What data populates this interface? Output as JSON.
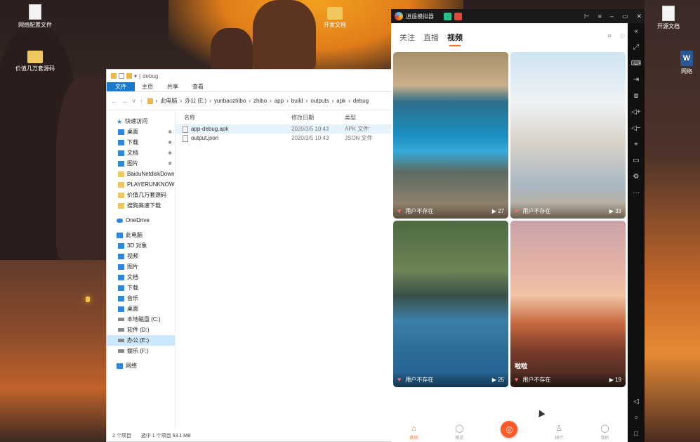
{
  "desktop": {
    "icons": [
      {
        "label": "网络配置文件",
        "kind": "file"
      },
      {
        "label": "价值几万套源码",
        "kind": "folder"
      },
      {
        "label": "开发文档",
        "kind": "folder"
      },
      {
        "label": "开源文档",
        "kind": "file"
      },
      {
        "label": "网络",
        "kind": "word"
      }
    ]
  },
  "explorer": {
    "title": "debug",
    "ribbon_tabs": [
      "文件",
      "主页",
      "共享",
      "查看"
    ],
    "path": [
      "此电脑",
      "办公 (E:)",
      "yunbaozhibo",
      "zhibo",
      "app",
      "build",
      "outputs",
      "apk",
      "debug"
    ],
    "nav": {
      "quick_access": "快速访问",
      "quick_items": [
        {
          "label": "桌面",
          "icon": "blue",
          "pinned": true
        },
        {
          "label": "下载",
          "icon": "blue",
          "pinned": true
        },
        {
          "label": "文档",
          "icon": "blue",
          "pinned": true
        },
        {
          "label": "图片",
          "icon": "blue",
          "pinned": true
        },
        {
          "label": "BaiduNetdiskDown",
          "icon": "yel",
          "pinned": false
        },
        {
          "label": "PLAYERUNKNOWN",
          "icon": "yel",
          "pinned": false
        },
        {
          "label": "价值几万套源码",
          "icon": "yel",
          "pinned": false
        },
        {
          "label": "搜狗高速下载",
          "icon": "yel",
          "pinned": false
        }
      ],
      "onedrive": "OneDrive",
      "this_pc": "此电脑",
      "pc_items": [
        {
          "label": "3D 对象",
          "icon": "blue"
        },
        {
          "label": "视频",
          "icon": "blue"
        },
        {
          "label": "图片",
          "icon": "blue"
        },
        {
          "label": "文档",
          "icon": "blue"
        },
        {
          "label": "下载",
          "icon": "blue"
        },
        {
          "label": "音乐",
          "icon": "blue"
        },
        {
          "label": "桌面",
          "icon": "blue"
        },
        {
          "label": "本地磁盘 (C:)",
          "icon": "gray"
        },
        {
          "label": "软件 (D:)",
          "icon": "gray"
        },
        {
          "label": "办公 (E:)",
          "icon": "gray",
          "selected": true
        },
        {
          "label": "娱乐 (F:)",
          "icon": "gray"
        }
      ],
      "network": "网络"
    },
    "columns": {
      "name": "名称",
      "date": "修改日期",
      "type": "类型"
    },
    "files": [
      {
        "name": "app-debug.apk",
        "date": "2020/3/5 10:43",
        "type": "APK 文件",
        "selected": true
      },
      {
        "name": "output.json",
        "date": "2020/3/5 10:43",
        "type": "JSON 文件",
        "selected": false
      }
    ],
    "status": {
      "count": "2 个项目",
      "selection": "选中 1 个项目  63.1 MB"
    }
  },
  "emulator": {
    "title": "逍遥模拟器",
    "top_tabs": [
      {
        "label": "关注",
        "active": false
      },
      {
        "label": "直播",
        "active": false
      },
      {
        "label": "视频",
        "active": true
      }
    ],
    "cards": [
      {
        "user": "用户不存在",
        "views": "27",
        "caption": ""
      },
      {
        "user": "用户不存在",
        "views": "33",
        "caption": ""
      },
      {
        "user": "用户不存在",
        "views": "25",
        "caption": ""
      },
      {
        "user": "用户不存在",
        "views": "19",
        "caption": "啦啦"
      }
    ],
    "bottom_nav": [
      {
        "label": "首页",
        "icon": "⌂",
        "active": true
      },
      {
        "label": "附近",
        "icon": "◯",
        "active": false
      },
      {
        "label": "",
        "icon": "◎",
        "center": true
      },
      {
        "label": "排行",
        "icon": "♙",
        "active": false
      },
      {
        "label": "我的",
        "icon": "◯",
        "active": false
      }
    ],
    "accent": "#ff6a2a"
  }
}
